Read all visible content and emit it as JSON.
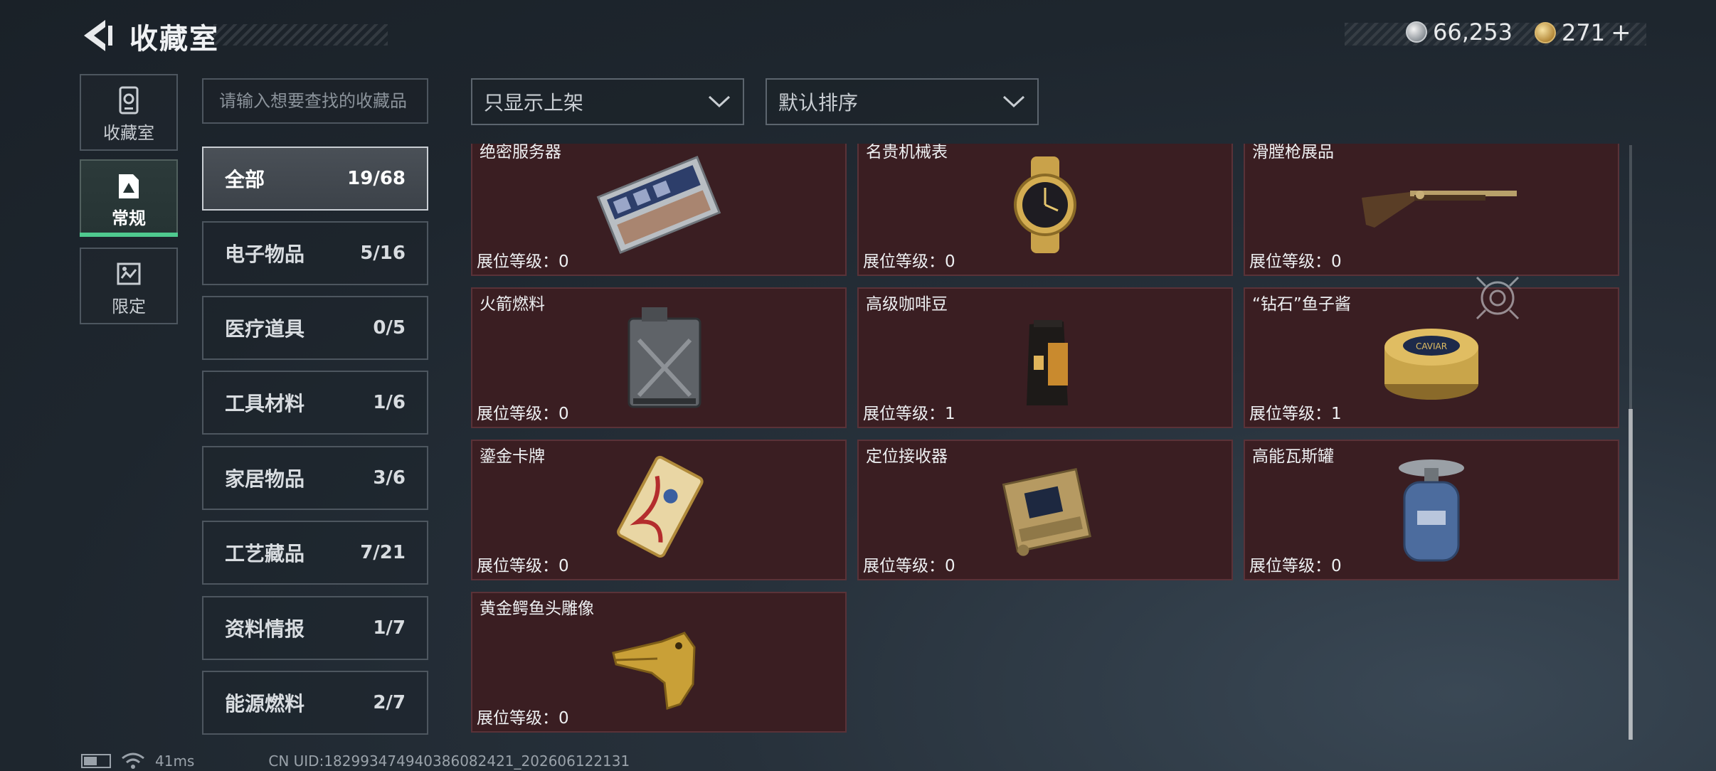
{
  "header": {
    "title": "收藏室"
  },
  "currency": {
    "silver": "66,253",
    "gold": "271",
    "gold_plus": "+"
  },
  "nav": [
    {
      "label": "收藏室",
      "icon": "collection-room-icon"
    },
    {
      "label": "常规",
      "icon": "regular-collection-icon",
      "active": true
    },
    {
      "label": "限定",
      "icon": "limited-collection-icon"
    }
  ],
  "search": {
    "placeholder": "请输入想要查找的收藏品",
    "value": ""
  },
  "filters": {
    "display": "只显示上架",
    "sort": "默认排序"
  },
  "categories": [
    {
      "name": "全部",
      "count": "19/68",
      "active": true
    },
    {
      "name": "电子物品",
      "count": "5/16"
    },
    {
      "name": "医疗道具",
      "count": "0/5"
    },
    {
      "name": "工具材料",
      "count": "1/6"
    },
    {
      "name": "家居物品",
      "count": "3/6"
    },
    {
      "name": "工艺藏品",
      "count": "7/21"
    },
    {
      "name": "资料情报",
      "count": "1/7"
    },
    {
      "name": "能源燃料",
      "count": "2/7"
    }
  ],
  "items": [
    {
      "name": "绝密服务器",
      "level": "展位等级：0",
      "icon": "server-icon"
    },
    {
      "name": "名贵机械表",
      "level": "展位等级：0",
      "icon": "watch-icon"
    },
    {
      "name": "滑膛枪展品",
      "level": "展位等级：0",
      "icon": "musket-icon"
    },
    {
      "name": "火箭燃料",
      "level": "展位等级：0",
      "icon": "fuel-can-icon"
    },
    {
      "name": "高级咖啡豆",
      "level": "展位等级：1",
      "icon": "coffee-bag-icon"
    },
    {
      "name": "“钻石”鱼子酱",
      "level": "展位等级：1",
      "icon": "caviar-tin-icon"
    },
    {
      "name": "鎏金卡牌",
      "level": "展位等级：0",
      "icon": "gilded-card-icon"
    },
    {
      "name": "定位接收器",
      "level": "展位等级：0",
      "icon": "receiver-icon"
    },
    {
      "name": "高能瓦斯罐",
      "level": "展位等级：0",
      "icon": "gas-canister-icon"
    },
    {
      "name": "黄金鳄鱼头雕像",
      "level": "展位等级：0",
      "icon": "crocodile-statue-icon"
    }
  ],
  "caviar_label": "CAVIAR",
  "footer": {
    "ping": "41ms",
    "uid": "CN UID:1829934749403860824​21_202606122131"
  },
  "colors": {
    "card_bg": "#3a1e22",
    "active_green": "#4fc98f",
    "gold": "#c9a54a"
  }
}
